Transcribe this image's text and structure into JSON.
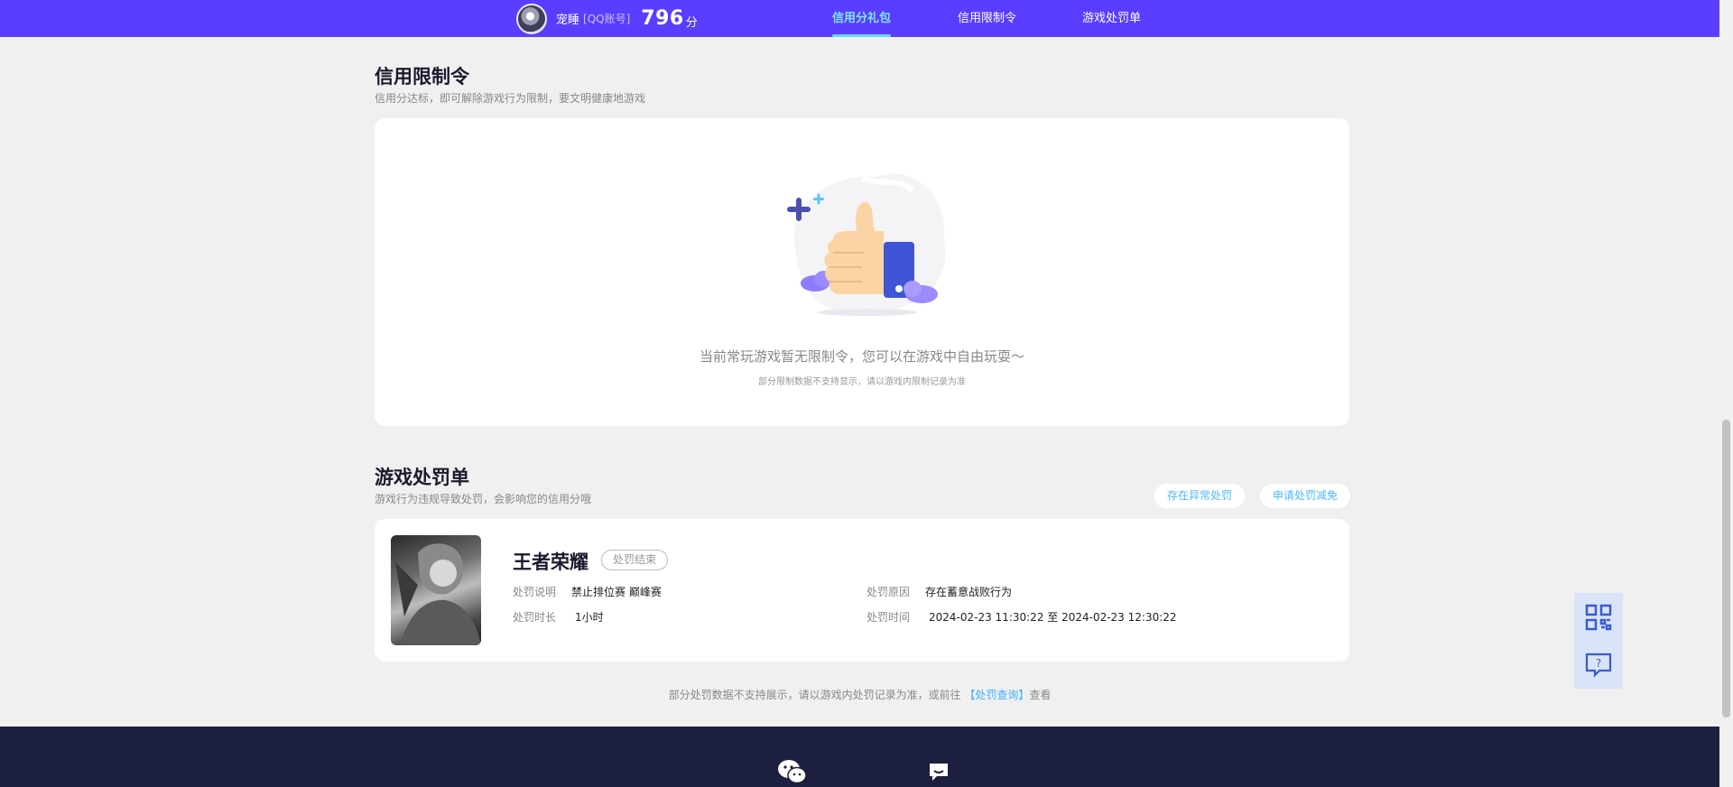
{
  "header": {
    "user": {
      "name": "宠睡",
      "account_type": "[QQ账号]",
      "score": "796",
      "score_unit": "分"
    },
    "nav": [
      {
        "label": "信用分礼包",
        "active": true
      },
      {
        "label": "信用限制令",
        "active": false
      },
      {
        "label": "游戏处罚单",
        "active": false
      }
    ]
  },
  "restriction": {
    "title": "信用限制令",
    "subtitle": "信用分达标，即可解除游戏行为限制，要文明健康地游戏",
    "empty_main": "当前常玩游戏暂无限制令，您可以在游戏中自由玩耍～",
    "empty_sub": "部分限制数据不支持显示，请以游戏内限制记录为准"
  },
  "penalty": {
    "title": "游戏处罚单",
    "subtitle": "游戏行为违规导致处罚，会影响您的信用分哦",
    "btn_abnormal": "存在异常处罚",
    "btn_appeal": "申请处罚减免",
    "item": {
      "game": "王者荣耀",
      "status": "处罚结束",
      "desc_label": "处罚说明",
      "desc_value": "禁止排位赛 巅峰赛",
      "duration_label": "处罚时长",
      "duration_value": "1小时",
      "reason_label": "处罚原因",
      "reason_value": "存在蓄意战败行为",
      "time_label": "处罚时间",
      "time_value": "2024-02-23 11:30:22 至 2024-02-23 12:30:22"
    },
    "note_prefix": "部分处罚数据不支持展示，请以游戏内处罚记录为准，或前往",
    "note_link": "【处罚查询】",
    "note_suffix": "查看"
  },
  "colors": {
    "brand": "#5a3eff",
    "accent": "#4cb8ff",
    "footer": "#1c1f3d"
  },
  "icons": {
    "footer_left": "wechat-icon",
    "footer_right": "message-icon",
    "side_top": "qrcode-icon",
    "side_bottom": "help-icon"
  }
}
